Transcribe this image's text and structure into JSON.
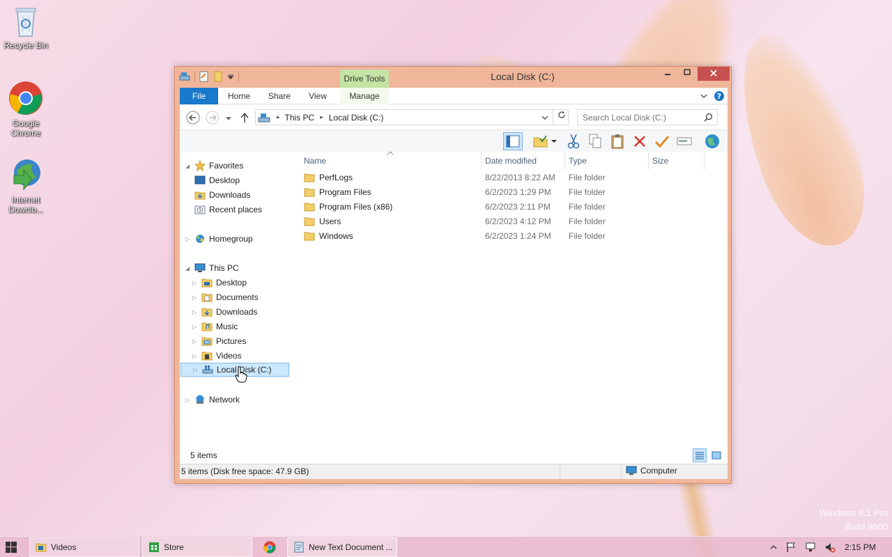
{
  "desktop": {
    "icons": [
      {
        "label": "Recycle Bin"
      },
      {
        "label": "Google Chrome"
      },
      {
        "label": "Internet Downlo..."
      }
    ],
    "watermark": {
      "line1": "Windows 8.1 Pro",
      "line2": "Build 9600"
    }
  },
  "window": {
    "title": "Local Disk (C:)",
    "context_tab": "Drive Tools",
    "ribbon_tabs": {
      "file": "File",
      "home": "Home",
      "share": "Share",
      "view": "View",
      "manage": "Manage"
    },
    "address": {
      "crumbs": [
        "This PC",
        "Local Disk (C:)"
      ]
    },
    "search": {
      "placeholder": "Search Local Disk (C:)"
    },
    "nav": {
      "favorites": "Favorites",
      "fav_items": [
        "Desktop",
        "Downloads",
        "Recent places"
      ],
      "homegroup": "Homegroup",
      "this_pc": "This PC",
      "pc_items": [
        "Desktop",
        "Documents",
        "Downloads",
        "Music",
        "Pictures",
        "Videos",
        "Local Disk (C:)"
      ],
      "network": "Network"
    },
    "columns": {
      "name": "Name",
      "date": "Date modified",
      "type": "Type",
      "size": "Size"
    },
    "files": [
      {
        "name": "PerfLogs",
        "date": "8/22/2013 8:22 AM",
        "type": "File folder"
      },
      {
        "name": "Program Files",
        "date": "6/2/2023 1:29 PM",
        "type": "File folder"
      },
      {
        "name": "Program Files (x86)",
        "date": "6/2/2023 2:11 PM",
        "type": "File folder"
      },
      {
        "name": "Users",
        "date": "6/2/2023 4:12 PM",
        "type": "File folder"
      },
      {
        "name": "Windows",
        "date": "6/2/2023 1:24 PM",
        "type": "File folder"
      }
    ],
    "status": {
      "count": "5 items"
    },
    "bottom": {
      "info": "5 items (Disk free space: 47.9 GB)",
      "zone": "Computer"
    }
  },
  "taskbar": {
    "items": [
      "Videos",
      "Store",
      "",
      "New Text Document ..."
    ],
    "clock": "2:15 PM"
  },
  "colors": {
    "accent": "#1979ca",
    "title_bar": "#f0b69a",
    "close": "#c75050",
    "drive_tools": "#c4e3a4"
  }
}
